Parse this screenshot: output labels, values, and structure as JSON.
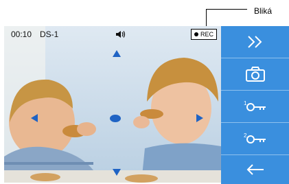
{
  "callout": {
    "label": "Bliká"
  },
  "video": {
    "time": "00:10",
    "camera": "DS-1",
    "rec_label": "REC"
  },
  "icons": {
    "speaker": "speaker-icon",
    "up": "arrow-up-icon",
    "down": "arrow-down-icon",
    "left": "arrow-left-icon",
    "right": "arrow-right-icon",
    "center": "center-dot-icon"
  },
  "side_panel": {
    "buttons": [
      {
        "name": "forward-button",
        "icon": "double-chevron-right-icon"
      },
      {
        "name": "snapshot-button",
        "icon": "camera-icon"
      },
      {
        "name": "unlock-1-button",
        "icon": "key-icon",
        "number": "1"
      },
      {
        "name": "unlock-2-button",
        "icon": "key-icon",
        "number": "2"
      },
      {
        "name": "back-button",
        "icon": "arrow-left-icon"
      }
    ]
  },
  "colors": {
    "panel": "#3a8fde",
    "arrow": "#1f63c4"
  }
}
